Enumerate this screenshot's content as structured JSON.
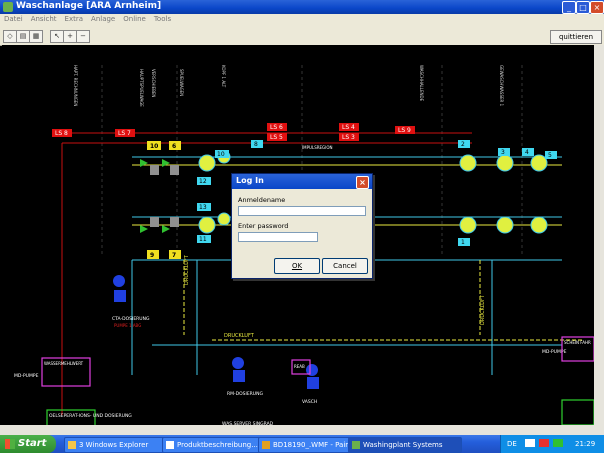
{
  "window": {
    "title": "Waschanlage [ARA Arnheim]",
    "minimize": "_",
    "restore": "□",
    "close": "×"
  },
  "menu": [
    "Datei",
    "Ansicht",
    "Extra",
    "Anlage",
    "Online",
    "Tools"
  ],
  "toolbar": {
    "quit_label": "quittieren",
    "icons": [
      "open-icon",
      "save-icon",
      "print-icon",
      "pointer-icon",
      "zoom-in-icon",
      "zoom-out-icon"
    ]
  },
  "schematic": {
    "lines_red": [
      "LS 8",
      "LS 7",
      "LS 6",
      "LS 5",
      "LS 4",
      "LS 3",
      "LS 9"
    ],
    "lines_red_label": "IMPULSREGION",
    "yellow_numbers": [
      "10",
      "6",
      "9",
      "7"
    ],
    "cyan_numbers": [
      "10",
      "12",
      "13",
      "11",
      "8",
      "2",
      "3",
      "4",
      "5",
      "1"
    ],
    "labels": [
      "HAPT. RECHNUNGEN",
      "HAUPTSPUELWAGE",
      "VERSCHIEBEN",
      "SPUELWAGEN",
      "KOPF 1 ALT",
      "WASCHHALLENDE",
      "GEWASCHWASSER 1",
      "DRUCKLUFT",
      "DRUCKLUFT",
      "CTA-DOSIERUNG",
      "PUMPE 1 ABG",
      "DRUCKLUFT",
      "RM-DOSIERUNG",
      "VASCH",
      "MD-PUMPE",
      "MD-PUMPE",
      "WAS.SERVER SINGRAD",
      "OELSEPERAT-IONS- UND DOSIERUNG",
      "REAB",
      "WASSERMEHLWERT",
      "SCHEIN FAHR"
    ]
  },
  "dialog": {
    "title": "Log In",
    "username_label": "Anmeldename",
    "username_value": "",
    "password_label": "Enter password",
    "password_value": "",
    "ok_label": "OK",
    "cancel_label": "Cancel"
  },
  "taskbar": {
    "start_label": "Start",
    "tasks": [
      "3 Windows Explorer",
      "Produktbeschreibung...",
      "BD18190_.WMF - Paint",
      "Washingplant Systems"
    ],
    "language": "DE",
    "time": "21:29"
  }
}
